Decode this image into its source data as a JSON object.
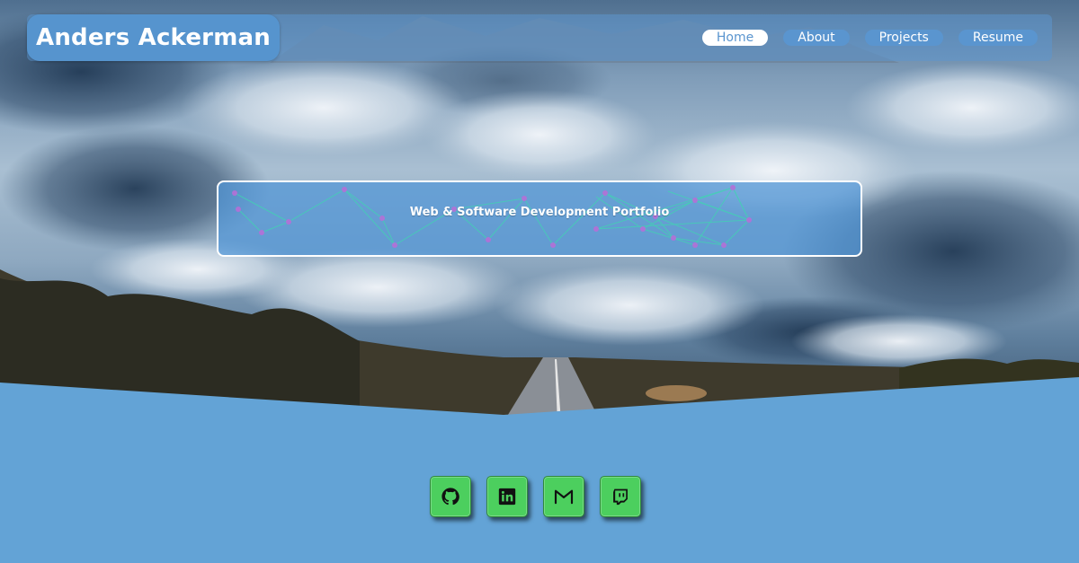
{
  "header": {
    "brand": "Anders Ackerman",
    "nav": [
      {
        "label": "Home",
        "active": true
      },
      {
        "label": "About",
        "active": false
      },
      {
        "label": "Projects",
        "active": false
      },
      {
        "label": "Resume",
        "active": false
      }
    ]
  },
  "hero": {
    "title": "Web & Software Development Portfolio"
  },
  "social": [
    {
      "icon": "github-icon"
    },
    {
      "icon": "linkedin-icon"
    },
    {
      "icon": "gmail-icon"
    },
    {
      "icon": "twitch-icon"
    }
  ],
  "colors": {
    "page_background": "#63a3d6",
    "nav_pill": "#5a95cf",
    "social_button": "#4ccf5e"
  }
}
